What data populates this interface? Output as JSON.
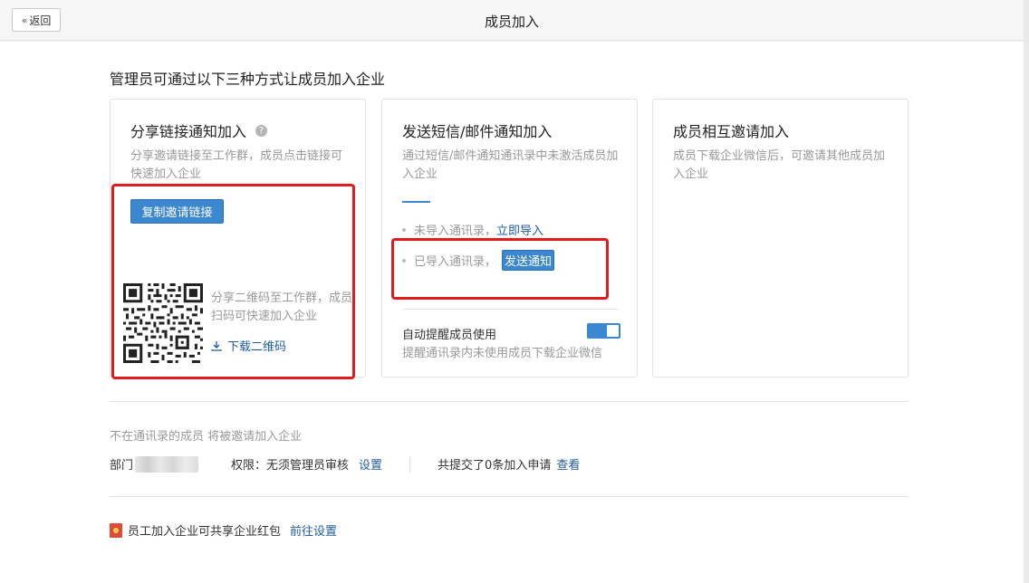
{
  "header": {
    "back_label": "返回",
    "title": "成员加入"
  },
  "intro": "管理员可通过以下三种方式让成员加入企业",
  "card_share": {
    "title": "分享链接通知加入",
    "desc": "分享邀请链接至工作群，成员点击链接可快速加入企业",
    "copy_button": "复制邀请链接",
    "qr_desc": "分享二维码至工作群，成员扫码可快速加入企业",
    "download_link": "下载二维码"
  },
  "card_sms": {
    "title": "发送短信/邮件通知加入",
    "desc": "通过短信/邮件通知通讯录中未激活成员加入企业",
    "row1_text": "未导入通讯录，",
    "row1_link": "立即导入",
    "row2_text": "已导入通讯录，",
    "row2_button": "发送通知",
    "remind_label": "自动提醒成员使用",
    "remind_on": true,
    "remind_desc": "提醒通讯录内未使用成员下载企业微信"
  },
  "card_invite": {
    "title": "成员相互邀请加入",
    "desc": "成员下载企业微信后，可邀请其他成员加入企业"
  },
  "not_in_contacts": "不在通讯录的成员 将被邀请加入企业",
  "dept_label": "部门",
  "permission_text": "权限：无须管理员审核",
  "permission_link": "设置",
  "applications_text": "共提交了0条加入申请",
  "applications_link": "查看",
  "redpacket_text": "员工加入企业可共享企业红包",
  "redpacket_link": "前往设置",
  "colors": {
    "accent": "#3b87d0",
    "highlight": "#e21c1c",
    "link": "#1f5c9e"
  }
}
